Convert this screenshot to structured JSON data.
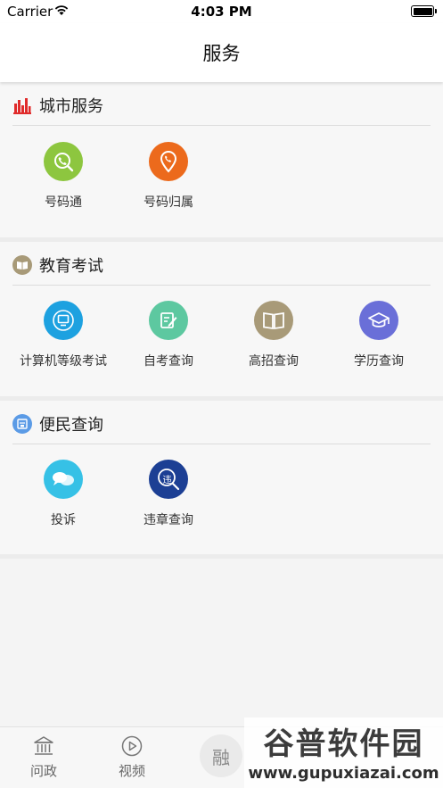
{
  "status_bar": {
    "carrier": "Carrier",
    "time": "4:03 PM"
  },
  "nav": {
    "title": "服务"
  },
  "sections": [
    {
      "title": "城市服务",
      "items": [
        {
          "label": "号码通",
          "icon": "phone-search-icon",
          "color": "#8dc63f"
        },
        {
          "label": "号码归属",
          "icon": "phone-location-icon",
          "color": "#ec6a1c"
        }
      ]
    },
    {
      "title": "教育考试",
      "items": [
        {
          "label": "计算机等级考试",
          "icon": "computer-icon",
          "color": "#1da1e0"
        },
        {
          "label": "自考查询",
          "icon": "edit-note-icon",
          "color": "#5dc8a0"
        },
        {
          "label": "高招查询",
          "icon": "book-icon",
          "color": "#a89a78"
        },
        {
          "label": "学历查询",
          "icon": "graduation-cap-icon",
          "color": "#6a6fd8"
        }
      ]
    },
    {
      "title": "便民查询",
      "items": [
        {
          "label": "投诉",
          "icon": "chat-bubbles-icon",
          "color": "#36c1e6"
        },
        {
          "label": "违章查询",
          "icon": "violation-search-icon",
          "color": "#1c3f94",
          "badge": "违"
        }
      ]
    }
  ],
  "tab_bar": {
    "items": [
      {
        "label": "问政",
        "icon": "government-building-icon"
      },
      {
        "label": "视频",
        "icon": "play-circle-icon"
      }
    ],
    "center": "融"
  },
  "watermark": {
    "title": "谷普软件园",
    "url": "www.gupuxiazai.com"
  }
}
